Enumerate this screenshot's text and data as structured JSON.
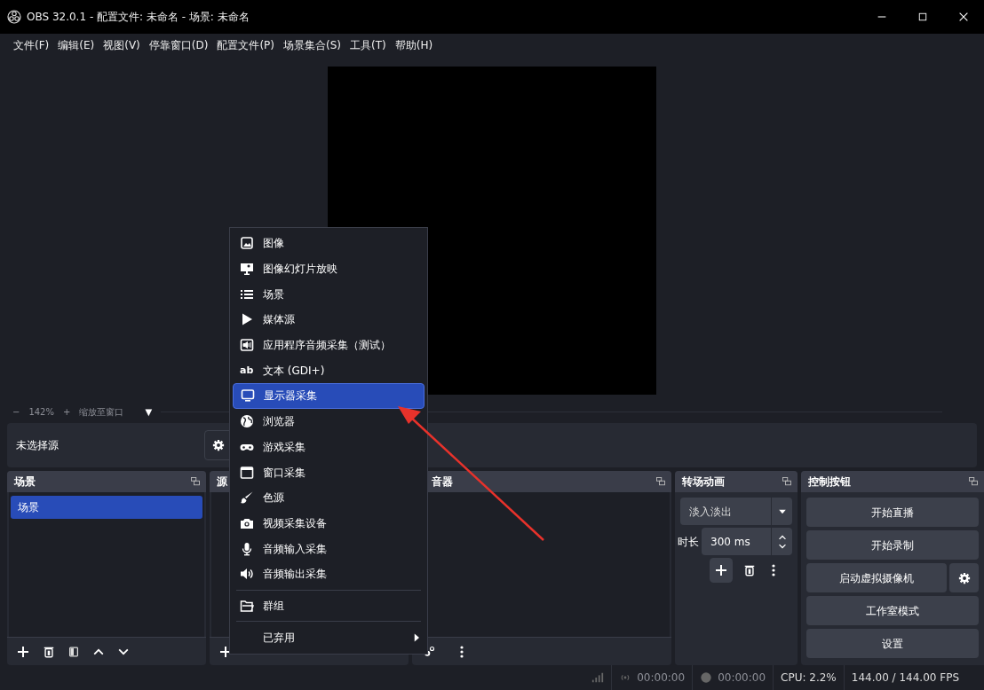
{
  "window": {
    "title": "OBS 32.0.1 - 配置文件: 未命名 - 场景: 未命名"
  },
  "menu_bar": [
    "文件(F)",
    "编辑(E)",
    "视图(V)",
    "停靠窗口(D)",
    "配置文件(P)",
    "场景集合(S)",
    "工具(T)",
    "帮助(H)"
  ],
  "zoom_bar": {
    "zoom_out": "−",
    "zoom": "142%",
    "zoom_in": "+",
    "fit": "缩放至窗口",
    "dropdown": "▼"
  },
  "source_bar": {
    "label": "未选择源"
  },
  "scenes": {
    "title": "场景",
    "items": [
      {
        "label": "场景",
        "selected": true
      }
    ]
  },
  "sources": {
    "title": "源"
  },
  "mixer": {
    "title": "音器"
  },
  "transitions": {
    "title": "转场动画",
    "transition": "淡入淡出",
    "duration_label": "时长",
    "duration": "300 ms"
  },
  "controls": {
    "title": "控制按钮",
    "buttons": [
      {
        "label": "开始直播",
        "kind": "plain"
      },
      {
        "label": "开始录制",
        "kind": "plain"
      },
      {
        "label": "启动虚拟摄像机",
        "kind": "with-settings"
      },
      {
        "label": "工作室模式",
        "kind": "plain"
      },
      {
        "label": "设置",
        "kind": "plain"
      }
    ]
  },
  "context_menu": {
    "items": [
      {
        "label": "图像",
        "selected": false,
        "separator_before": false,
        "submenu": false
      },
      {
        "label": "图像幻灯片放映",
        "selected": false,
        "separator_before": false,
        "submenu": false
      },
      {
        "label": "场景",
        "selected": false,
        "separator_before": false,
        "submenu": false
      },
      {
        "label": "媒体源",
        "selected": false,
        "separator_before": false,
        "submenu": false
      },
      {
        "label": "应用程序音频采集（测试）",
        "selected": false,
        "separator_before": false,
        "submenu": false
      },
      {
        "label": "文本 (GDI+)",
        "icon_text": "ab",
        "selected": false,
        "separator_before": false,
        "submenu": false
      },
      {
        "label": "显示器采集",
        "selected": true,
        "separator_before": false,
        "submenu": false
      },
      {
        "label": "浏览器",
        "selected": false,
        "separator_before": false,
        "submenu": false
      },
      {
        "label": "游戏采集",
        "selected": false,
        "separator_before": false,
        "submenu": false
      },
      {
        "label": "窗口采集",
        "selected": false,
        "separator_before": false,
        "submenu": false
      },
      {
        "label": "色源",
        "selected": false,
        "separator_before": false,
        "submenu": false
      },
      {
        "label": "视频采集设备",
        "selected": false,
        "separator_before": false,
        "submenu": false
      },
      {
        "label": "音频输入采集",
        "selected": false,
        "separator_before": false,
        "submenu": false
      },
      {
        "label": "音频输出采集",
        "selected": false,
        "separator_before": false,
        "submenu": false
      },
      {
        "label": "群组",
        "selected": false,
        "separator_before": true,
        "submenu": false
      },
      {
        "label": "已弃用",
        "selected": false,
        "separator_before": true,
        "submenu": true
      }
    ]
  },
  "status_bar": {
    "stream_time": "00:00:00",
    "record_time": "00:00:00",
    "cpu": "CPU: 2.2%",
    "fps": "144.00 / 144.00 FPS"
  }
}
